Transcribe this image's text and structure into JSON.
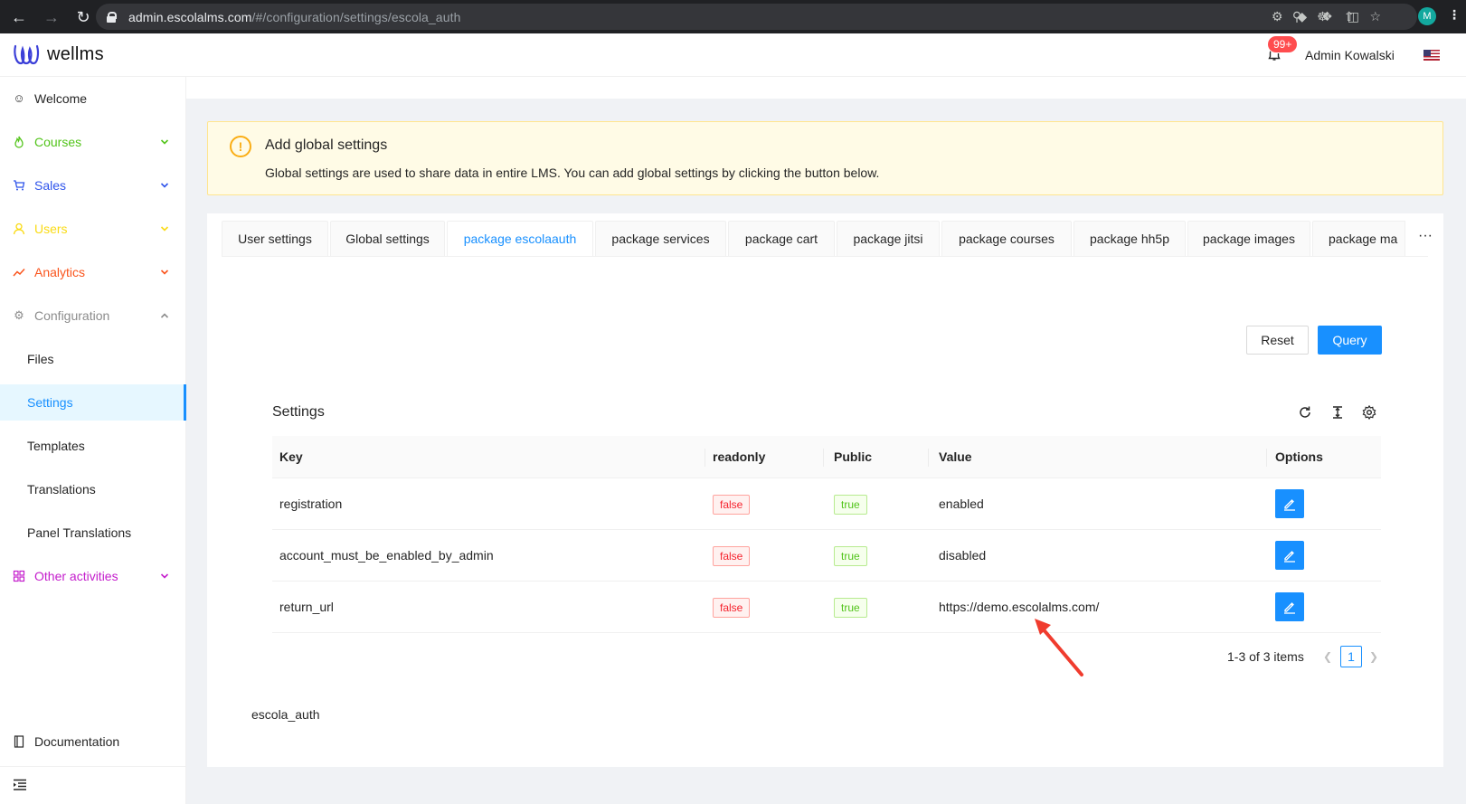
{
  "browser": {
    "url_host": "admin.escolalms.com",
    "url_path": "/#/configuration/settings/escola_auth",
    "profile_initial": "M"
  },
  "header": {
    "logo_text": "wellms",
    "notifications_badge": "99+",
    "user_name": "Admin Kowalski"
  },
  "sidebar": {
    "items": [
      {
        "label": "Welcome",
        "icon": "smile-icon",
        "color": "#262626"
      },
      {
        "label": "Courses",
        "icon": "fire-icon",
        "color": "#52c41a"
      },
      {
        "label": "Sales",
        "icon": "cart-icon",
        "color": "#2f54eb"
      },
      {
        "label": "Users",
        "icon": "user-icon",
        "color": "#fadb14"
      },
      {
        "label": "Analytics",
        "icon": "chart-line-icon",
        "color": "#fa541c"
      },
      {
        "label": "Configuration",
        "icon": "gear-icon",
        "color": "#8c8c8c"
      },
      {
        "label": "Other activities",
        "icon": "apps-icon",
        "color": "#c41dcc"
      }
    ],
    "sub_items": [
      "Files",
      "Settings",
      "Templates",
      "Translations",
      "Panel Translations"
    ],
    "active_sub": "Settings",
    "documentation": "Documentation"
  },
  "alert": {
    "title": "Add global settings",
    "description": "Global settings are used to share data in entire LMS. You can add global settings by clicking the button below."
  },
  "tabs": [
    "User settings",
    "Global settings",
    "package escolaauth",
    "package services",
    "package cart",
    "package jitsi",
    "package courses",
    "package hh5p",
    "package images",
    "package ma"
  ],
  "active_tab": "package escolaauth",
  "tab_more": "···",
  "buttons": {
    "reset": "Reset",
    "query": "Query"
  },
  "table": {
    "title": "Settings",
    "columns": [
      "Key",
      "readonly",
      "Public",
      "Value",
      "Options"
    ],
    "rows": [
      {
        "key": "registration",
        "readonly": "false",
        "public": "true",
        "value": "enabled"
      },
      {
        "key": "account_must_be_enabled_by_admin",
        "readonly": "false",
        "public": "true",
        "value": "disabled"
      },
      {
        "key": "return_url",
        "readonly": "false",
        "public": "true",
        "value": "https://demo.escolalms.com/"
      }
    ]
  },
  "pagination": {
    "total_text": "1-3 of 3 items",
    "current_page": "1"
  },
  "footer_key": "escola_auth",
  "colors": {
    "primary": "#1890ff",
    "warning_bg": "#fffbe6",
    "annotation_arrow": "#f03c2e"
  }
}
